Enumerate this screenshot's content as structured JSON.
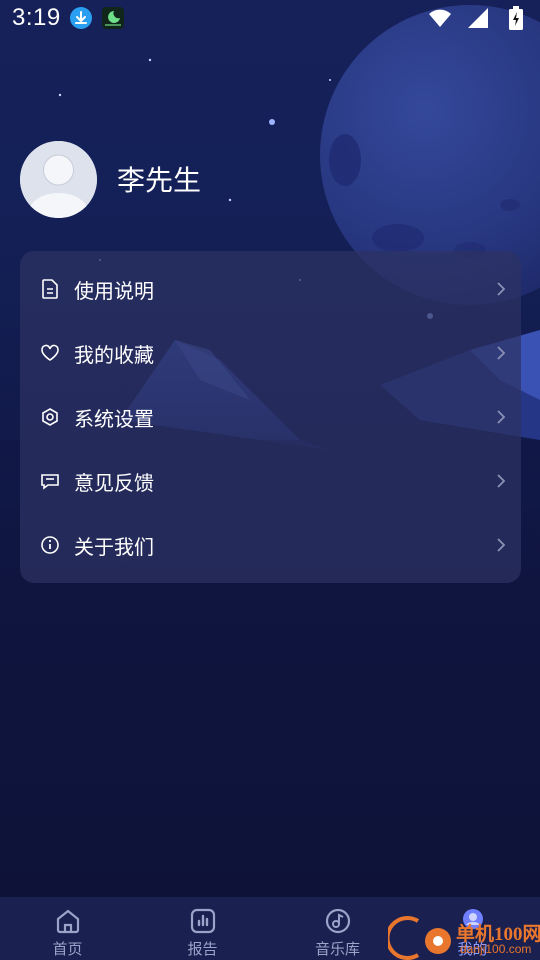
{
  "status_bar": {
    "time": "3:19",
    "icons": [
      "download-icon",
      "app-notification-icon",
      "wifi-icon",
      "signal-icon",
      "battery-charging-icon"
    ]
  },
  "profile": {
    "name": "李先生"
  },
  "menu": {
    "items": [
      {
        "label": "使用说明",
        "icon": "document-icon"
      },
      {
        "label": "我的收藏",
        "icon": "heart-icon"
      },
      {
        "label": "系统设置",
        "icon": "settings-icon"
      },
      {
        "label": "意见反馈",
        "icon": "feedback-icon"
      },
      {
        "label": "关于我们",
        "icon": "info-icon"
      }
    ]
  },
  "bottom_nav": {
    "items": [
      {
        "label": "首页",
        "icon": "home-icon"
      },
      {
        "label": "报告",
        "icon": "report-icon"
      },
      {
        "label": "音乐库",
        "icon": "music-library-icon"
      },
      {
        "label": "我的",
        "icon": "profile-icon",
        "active": true
      }
    ]
  },
  "watermark": {
    "text": "单机100网",
    "url": "danji100.com"
  },
  "colors": {
    "background": "#0e1238",
    "card": "#2c3262",
    "nav_bg": "#1a2050",
    "active_accent": "#8d9cff",
    "watermark": "#e8762d"
  }
}
